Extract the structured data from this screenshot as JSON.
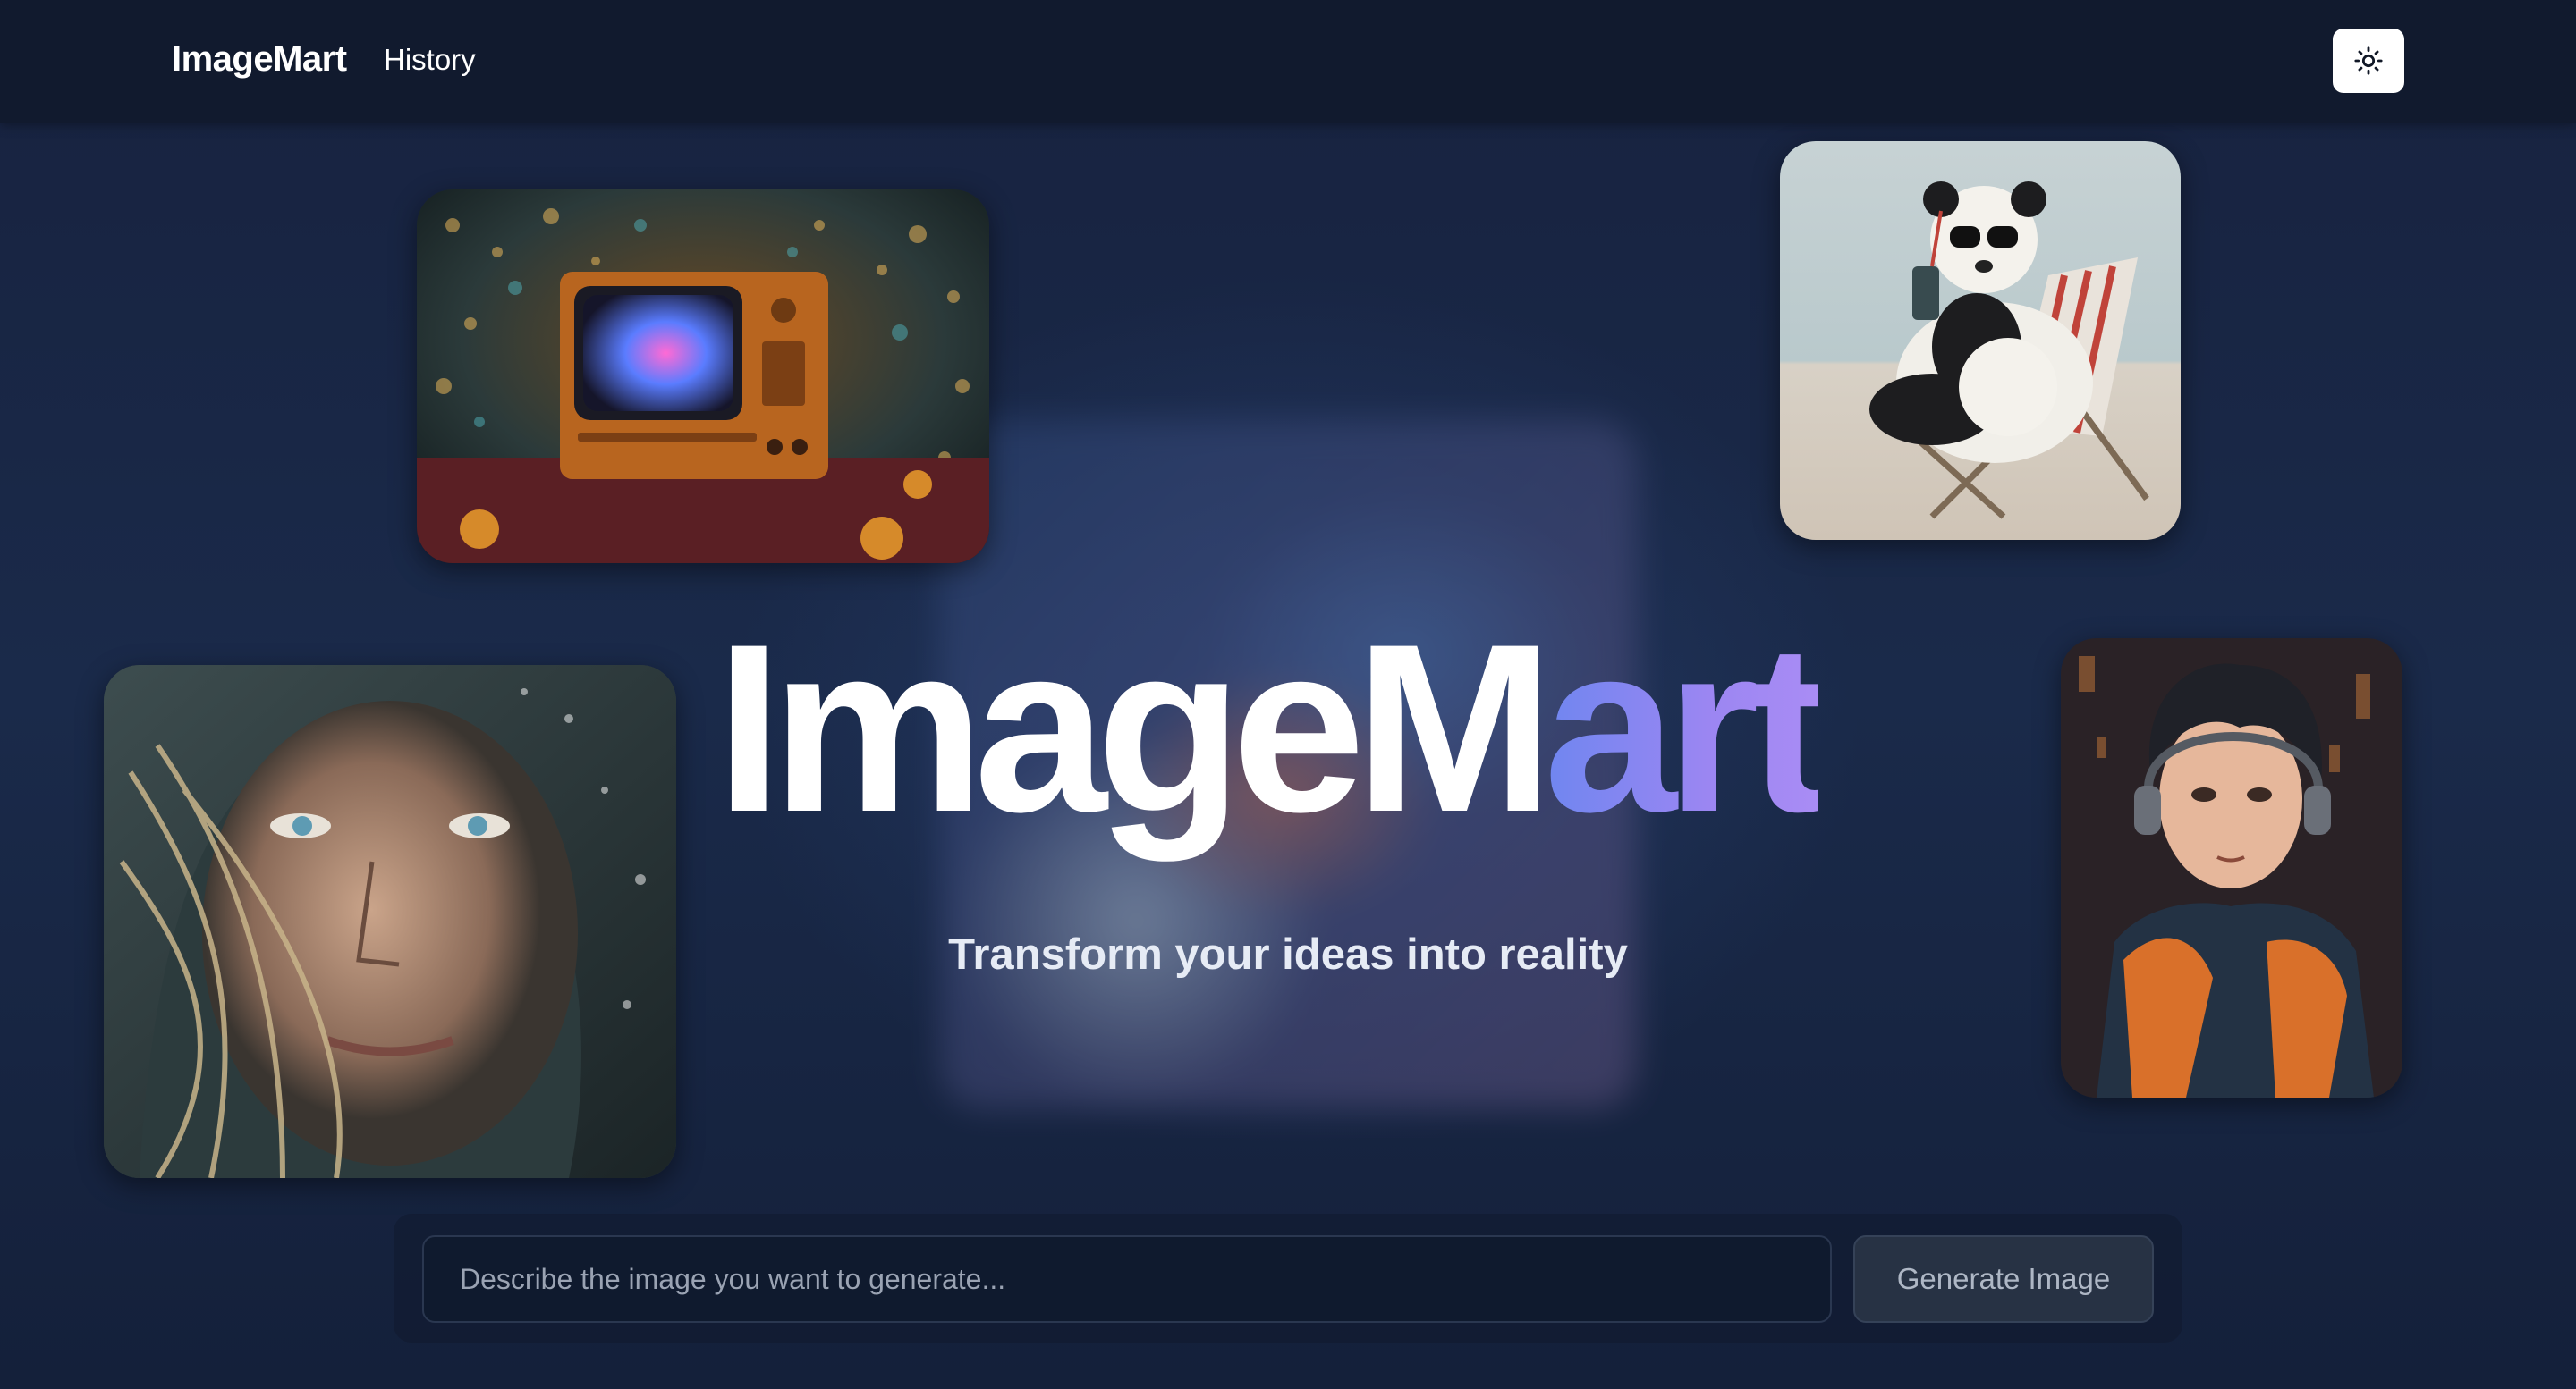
{
  "header": {
    "brand": "ImageMart",
    "nav_history": "History",
    "theme_toggle_icon": "sun-icon"
  },
  "hero": {
    "title_main": "ImageM",
    "title_accent": "art",
    "subtitle": "Transform your ideas into reality"
  },
  "gallery": [
    {
      "name": "retro-tv-image",
      "icon": "image"
    },
    {
      "name": "panda-beach-chair-image",
      "icon": "image"
    },
    {
      "name": "hooded-woman-portrait-image",
      "icon": "image"
    },
    {
      "name": "anime-headphones-image",
      "icon": "image"
    }
  ],
  "prompt": {
    "placeholder": "Describe the image you want to generate...",
    "value": "",
    "generate_label": "Generate Image"
  },
  "colors": {
    "background": "#14203a",
    "header_bg": "#111a2e",
    "accent_start": "#6f86f0",
    "accent_end": "#a98cf4"
  }
}
